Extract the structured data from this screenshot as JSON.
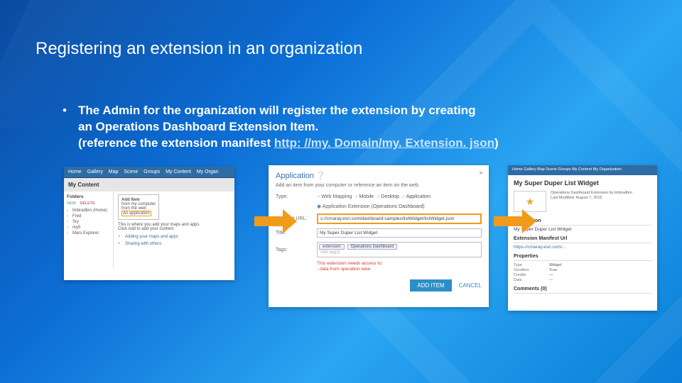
{
  "title": "Registering an extension in an organization",
  "bullet": {
    "line1": "The Admin for the organization will register the extension by creating",
    "line2": "an Operations Dashboard Extension Item.",
    "line3a": "(reference the extension manifest ",
    "link": "http: //my. Domain/my. Extension. json",
    "line3b": ")"
  },
  "panel1": {
    "nav": [
      "Home",
      "Gallery",
      "Map",
      "Scene",
      "Groups",
      "My Content",
      "My Organ"
    ],
    "tab": "My Content",
    "foldersHdr": "Folders",
    "actions": {
      "new": "NEW",
      "del": "DELETE"
    },
    "folders": [
      "tmbradbro (Home)",
      "Fred",
      "Sry",
      "my5",
      "Mars Explorer"
    ],
    "addItem": {
      "h": "Add Item",
      "o1": "from my computer",
      "o2": "from the web",
      "o3": "An application"
    },
    "note": "This is where you add your maps and apps.",
    "hint": "Click Add to add your content.",
    "tips": [
      "Adding your maps and apps",
      "Sharing with others"
    ]
  },
  "panel2": {
    "heading": "Application",
    "sub": "Add an item from your computer or reference an item on the web.",
    "typeLbl": "Type:",
    "types": [
      "Web Mapping",
      "Mobile",
      "Desktop",
      "Application"
    ],
    "selType": "Application Extension (Operations Dashboard)",
    "manifestLbl": "Manifest URL:",
    "manifestVal": "s://cmaray.esri.com/dashboard-samples/listWidget/listWidget.json",
    "titleLbl": "Title:",
    "titleVal": "My Super Duper List Widget",
    "tagsLbl": "Tags:",
    "tag1": "extension",
    "tag2": "Operations Dashboard",
    "tagPh": "Add tag(s)",
    "desc1": "This extension needs access to:",
    "desc2": "- data from operation view",
    "addBtn": "ADD ITEM",
    "cancel": "CANCEL"
  },
  "panel3": {
    "crumb": "Home  Gallery  Map  Scene  Groups  My Content  My Organization",
    "title": "My Super Duper List Widget",
    "meta1": "Operations Dashboard Extension by tmbradbro",
    "meta2": "Last Modified: August 7, 2015",
    "h1": "Description",
    "d1": "My Super Duper List Widget",
    "h2": "Extension Manifest Url",
    "d2": "https://cmaray.esri.com/...",
    "h3": "Properties",
    "props": [
      [
        "Type",
        "Widget"
      ],
      [
        "Sandbox",
        "True"
      ],
      [
        "Credits",
        "—"
      ],
      [
        "Data",
        "—"
      ]
    ],
    "h4": "Comments (0)"
  }
}
